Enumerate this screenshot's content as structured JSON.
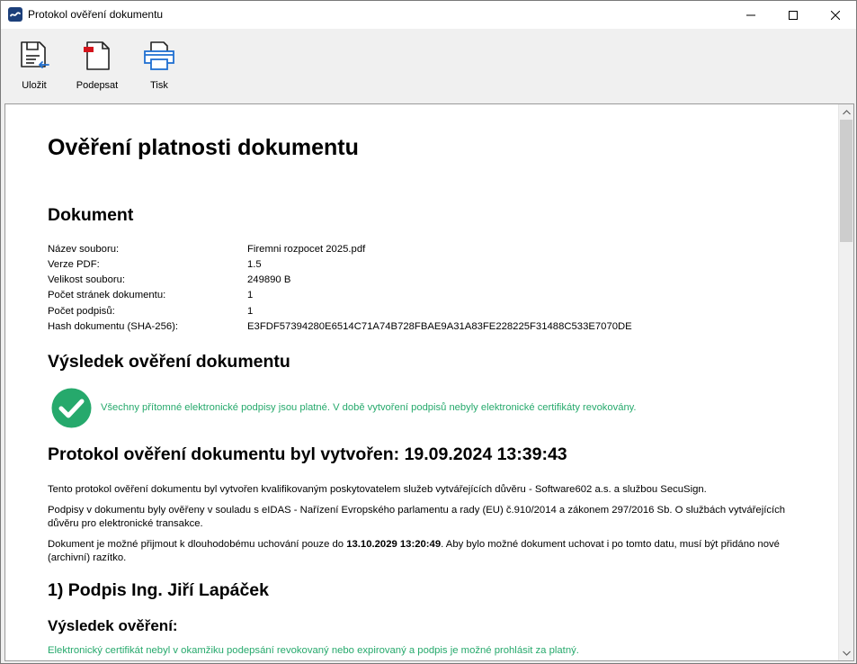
{
  "window": {
    "title": "Protokol ověření dokumentu"
  },
  "toolbar": {
    "save_label": "Uložit",
    "sign_label": "Podepsat",
    "print_label": "Tisk"
  },
  "document": {
    "heading": "Ověření platnosti dokumentu",
    "section_document": "Dokument",
    "info": [
      {
        "key": "Název souboru:",
        "value": "Firemni rozpocet 2025.pdf"
      },
      {
        "key": "Verze PDF:",
        "value": "1.5"
      },
      {
        "key": "Velikost souboru:",
        "value": "249890 B"
      },
      {
        "key": "Počet stránek dokumentu:",
        "value": "1"
      },
      {
        "key": "Počet podpisů:",
        "value": "1"
      },
      {
        "key": "Hash dokumentu (SHA-256):",
        "value": "E3FDF57394280E6514C71A74B728FBAE9A31A83FE228225F31488C533E7070DE"
      }
    ],
    "section_result": "Výsledek ověření dokumentu",
    "result_text": "Všechny přítomné elektronické podpisy jsou platné. V době vytvoření podpisů nebyly elektronické certifikáty revokovány.",
    "protocol_heading": "Protokol ověření dokumentu byl vytvořen: 19.09.2024 13:39:43",
    "para1": "Tento protokol ověření dokumentu byl vytvořen kvalifikovaným poskytovatelem služeb vytvářejících důvěru - Software602 a.s. a službou SecuSign.",
    "para2": "Podpisy v dokumentu byly ověřeny v souladu s eIDAS - Nařízení Evropského parlamentu a rady (EU) č.910/2014 a zákonem 297/2016 Sb. O službách vytvářejících důvěru pro elektronické transakce.",
    "para3_before": "Dokument je možné přijmout k dlouhodobému uchování pouze do ",
    "para3_date": "13.10.2029 13:20:49",
    "para3_after": ". Aby bylo možné dokument uchovat i po tomto datu, musí být přidáno nové (archivní) razítko.",
    "signature_heading": "1) Podpis Ing. Jiří Lapáček",
    "signature_result_heading": "Výsledek ověření:",
    "signature_result_text": "Elektronický certifikát nebyl v okamžiku podepsání revokovaný nebo expirovaný a podpis je možné prohlásit za platný."
  },
  "colors": {
    "accent_green": "#26a96c",
    "print_blue": "#1f6fd1",
    "sign_red": "#d4141c"
  }
}
